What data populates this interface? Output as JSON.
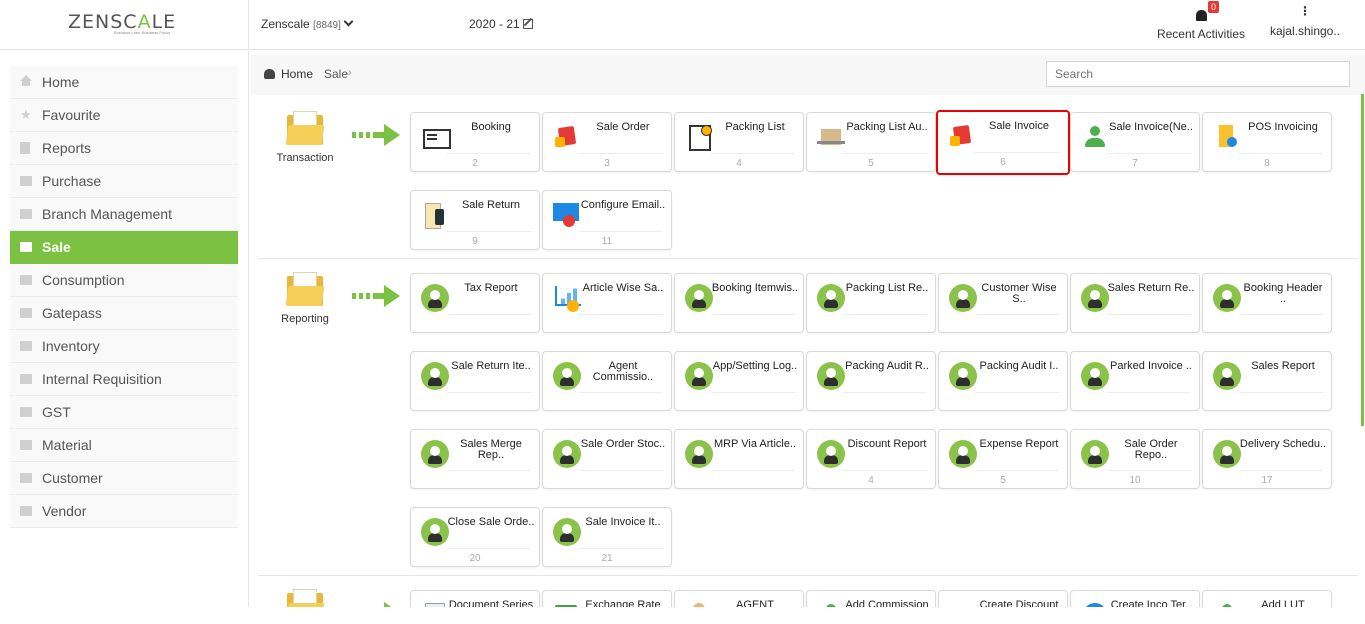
{
  "header": {
    "logo_left": "ZENSC",
    "logo_accent": "A",
    "logo_right": "LE",
    "tagline": "Business Less. Business Focus",
    "company": "Zenscale",
    "company_code": "[8849]",
    "fiscal_year": "2020 - 21",
    "notification_count": "0",
    "recent_label": "Recent Activities",
    "user": "kajal.shingo.."
  },
  "sidebar": {
    "items": [
      {
        "label": "Home",
        "icon": "home-icon"
      },
      {
        "label": "Favourite",
        "icon": "star-icon"
      },
      {
        "label": "Reports",
        "icon": "document-icon"
      },
      {
        "label": "Purchase",
        "icon": "folder-icon"
      },
      {
        "label": "Branch Management",
        "icon": "folder-icon"
      },
      {
        "label": "Sale",
        "icon": "folder-icon",
        "active": true
      },
      {
        "label": "Consumption",
        "icon": "folder-icon"
      },
      {
        "label": "Gatepass",
        "icon": "folder-icon"
      },
      {
        "label": "Inventory",
        "icon": "folder-icon"
      },
      {
        "label": "Internal Requisition",
        "icon": "folder-icon"
      },
      {
        "label": "GST",
        "icon": "folder-icon"
      },
      {
        "label": "Material",
        "icon": "folder-icon"
      },
      {
        "label": "Customer",
        "icon": "folder-icon"
      },
      {
        "label": "Vendor",
        "icon": "folder-icon"
      }
    ]
  },
  "breadcrumb": {
    "home": "Home",
    "current": "Sale",
    "separator": "›"
  },
  "search": {
    "placeholder": "Search"
  },
  "sections": {
    "transaction": {
      "label": "Transaction",
      "tiles": [
        {
          "name": "Booking",
          "num": "2",
          "icon": "booking-icon"
        },
        {
          "name": "Sale Order",
          "num": "3",
          "icon": "shopping-bag-icon"
        },
        {
          "name": "Packing List",
          "num": "4",
          "icon": "checklist-icon"
        },
        {
          "name": "Packing List Au..",
          "num": "5",
          "icon": "boxes-icon"
        },
        {
          "name": "Sale Invoice",
          "num": "6",
          "icon": "shopping-bag-icon",
          "highlighted": true
        },
        {
          "name": "Sale Invoice(Ne..",
          "num": "7",
          "icon": "person-icon"
        },
        {
          "name": "POS Invoicing",
          "num": "8",
          "icon": "pos-icon"
        },
        {
          "name": "Sale Return",
          "num": "9",
          "icon": "receipt-icon"
        },
        {
          "name": "Configure Email..",
          "num": "11",
          "icon": "email-settings-icon"
        }
      ]
    },
    "reporting": {
      "label": "Reporting",
      "tiles": [
        {
          "name": "Tax Report",
          "num": "",
          "icon": "report-user-icon"
        },
        {
          "name": "Article Wise Sa..",
          "num": "",
          "icon": "chart-icon"
        },
        {
          "name": "Booking Itemwis..",
          "num": "",
          "icon": "report-user-icon"
        },
        {
          "name": "Packing List Re..",
          "num": "",
          "icon": "report-user-icon"
        },
        {
          "name": "Customer Wise S..",
          "num": "",
          "icon": "report-user-icon"
        },
        {
          "name": "Sales Return Re..",
          "num": "",
          "icon": "report-user-icon"
        },
        {
          "name": "Booking Header ..",
          "num": "",
          "icon": "report-user-icon"
        },
        {
          "name": "Sale Return Ite..",
          "num": "",
          "icon": "report-user-icon"
        },
        {
          "name": "Agent Commissio..",
          "num": "",
          "icon": "report-user-icon"
        },
        {
          "name": "App/Setting Log..",
          "num": "",
          "icon": "report-user-icon"
        },
        {
          "name": "Packing Audit R..",
          "num": "",
          "icon": "report-user-icon"
        },
        {
          "name": "Packing Audit I..",
          "num": "",
          "icon": "report-user-icon"
        },
        {
          "name": "Parked Invoice ..",
          "num": "",
          "icon": "report-user-icon"
        },
        {
          "name": "Sales Report",
          "num": "",
          "icon": "report-user-icon"
        },
        {
          "name": "Sales Merge Rep..",
          "num": "",
          "icon": "report-user-icon"
        },
        {
          "name": "Sale Order Stoc..",
          "num": "",
          "icon": "report-user-icon"
        },
        {
          "name": "MRP Via Article..",
          "num": "",
          "icon": "report-user-icon"
        },
        {
          "name": "Discount Report",
          "num": "4",
          "icon": "report-user-icon"
        },
        {
          "name": "Expense Report",
          "num": "5",
          "icon": "report-user-icon"
        },
        {
          "name": "Sale Order Repo..",
          "num": "10",
          "icon": "report-user-icon"
        },
        {
          "name": "Delivery Schedu..",
          "num": "17",
          "icon": "report-user-icon"
        },
        {
          "name": "Close Sale Orde..",
          "num": "20",
          "icon": "report-user-icon"
        },
        {
          "name": "Sale Invoice It..",
          "num": "21",
          "icon": "report-user-icon"
        }
      ]
    },
    "master": {
      "tiles": [
        {
          "name": "Document Series",
          "num": "",
          "icon": "document-icon"
        },
        {
          "name": "Exchange Rate",
          "num": "",
          "icon": "money-icon"
        },
        {
          "name": "AGENT",
          "num": "",
          "icon": "agent-icon"
        },
        {
          "name": "Add Commission",
          "num": "",
          "icon": "person-icon"
        },
        {
          "name": "Create Discount",
          "num": "",
          "icon": "discount-icon"
        },
        {
          "name": "Create Inco Ter..",
          "num": "",
          "icon": "inco-icon"
        },
        {
          "name": "Add LUT",
          "num": "",
          "icon": "person-icon"
        }
      ]
    }
  }
}
